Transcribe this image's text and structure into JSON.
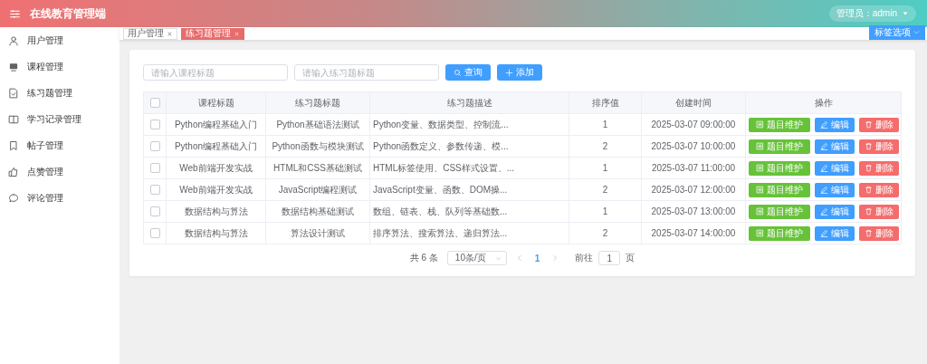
{
  "header": {
    "title": "在线教育管理端",
    "user_menu": "管理员：admin"
  },
  "sidebar": {
    "items": [
      {
        "label": "用户管理",
        "selected": false
      },
      {
        "label": "课程管理",
        "selected": false
      },
      {
        "label": "练习题管理",
        "selected": false
      },
      {
        "label": "学习记录管理",
        "selected": false
      },
      {
        "label": "帖子管理",
        "selected": false
      },
      {
        "label": "点赞管理",
        "selected": false
      },
      {
        "label": "评论管理",
        "selected": false
      }
    ]
  },
  "tabs": [
    {
      "label": "用户管理",
      "selected": false
    },
    {
      "label": "练习题管理",
      "selected": true
    }
  ],
  "tab_options": "标签选项",
  "search": {
    "fields": [
      {
        "placeholder": "请输入课程标题"
      },
      {
        "placeholder": "请输入练习题标题"
      }
    ],
    "buttons": [
      {
        "label": "查询",
        "kind": "search"
      },
      {
        "label": "添加",
        "kind": "add"
      }
    ]
  },
  "table": {
    "header_checked": false,
    "columns": [
      "课程标题",
      "练习题标题",
      "练习题描述",
      "排序值",
      "创建时间",
      "操作"
    ],
    "rows": [
      {
        "checked": false,
        "cells": [
          "Python编程基础入门",
          "Python基础语法测试",
          "Python变量、数据类型、控制流...",
          "1",
          "2025-03-07 09:00:00"
        ],
        "actions": [
          {
            "label": "题目维护",
            "kind": "maintain"
          },
          {
            "label": "编辑",
            "kind": "edit"
          },
          {
            "label": "删除",
            "kind": "delete"
          }
        ]
      },
      {
        "checked": false,
        "cells": [
          "Python编程基础入门",
          "Python函数与模块测试",
          "Python函数定义、参数传递、模...",
          "2",
          "2025-03-07 10:00:00"
        ],
        "actions": [
          {
            "label": "题目维护",
            "kind": "maintain"
          },
          {
            "label": "编辑",
            "kind": "edit"
          },
          {
            "label": "删除",
            "kind": "delete"
          }
        ]
      },
      {
        "checked": false,
        "cells": [
          "Web前端开发实战",
          "HTML和CSS基础测试",
          "HTML标签使用、CSS样式设置、...",
          "1",
          "2025-03-07 11:00:00"
        ],
        "actions": [
          {
            "label": "题目维护",
            "kind": "maintain"
          },
          {
            "label": "编辑",
            "kind": "edit"
          },
          {
            "label": "删除",
            "kind": "delete"
          }
        ]
      },
      {
        "checked": false,
        "cells": [
          "Web前端开发实战",
          "JavaScript编程测试",
          "JavaScript变量、函数、DOM操...",
          "2",
          "2025-03-07 12:00:00"
        ],
        "actions": [
          {
            "label": "题目维护",
            "kind": "maintain"
          },
          {
            "label": "编辑",
            "kind": "edit"
          },
          {
            "label": "删除",
            "kind": "delete"
          }
        ]
      },
      {
        "checked": false,
        "cells": [
          "数据结构与算法",
          "数据结构基础测试",
          "数组、链表、栈、队列等基础数...",
          "1",
          "2025-03-07 13:00:00"
        ],
        "actions": [
          {
            "label": "题目维护",
            "kind": "maintain"
          },
          {
            "label": "编辑",
            "kind": "edit"
          },
          {
            "label": "删除",
            "kind": "delete"
          }
        ]
      },
      {
        "checked": false,
        "cells": [
          "数据结构与算法",
          "算法设计测试",
          "排序算法、搜索算法、递归算法...",
          "2",
          "2025-03-07 14:00:00"
        ],
        "actions": [
          {
            "label": "题目维护",
            "kind": "maintain"
          },
          {
            "label": "编辑",
            "kind": "edit"
          },
          {
            "label": "删除",
            "kind": "delete"
          }
        ]
      }
    ]
  },
  "pagination": {
    "total": "共 6 条",
    "page_size": "10条/页",
    "pages": [
      {
        "label": "1",
        "selected": true
      }
    ],
    "jump_label": "前往",
    "jump_value": "1",
    "jump_suffix": "页"
  }
}
